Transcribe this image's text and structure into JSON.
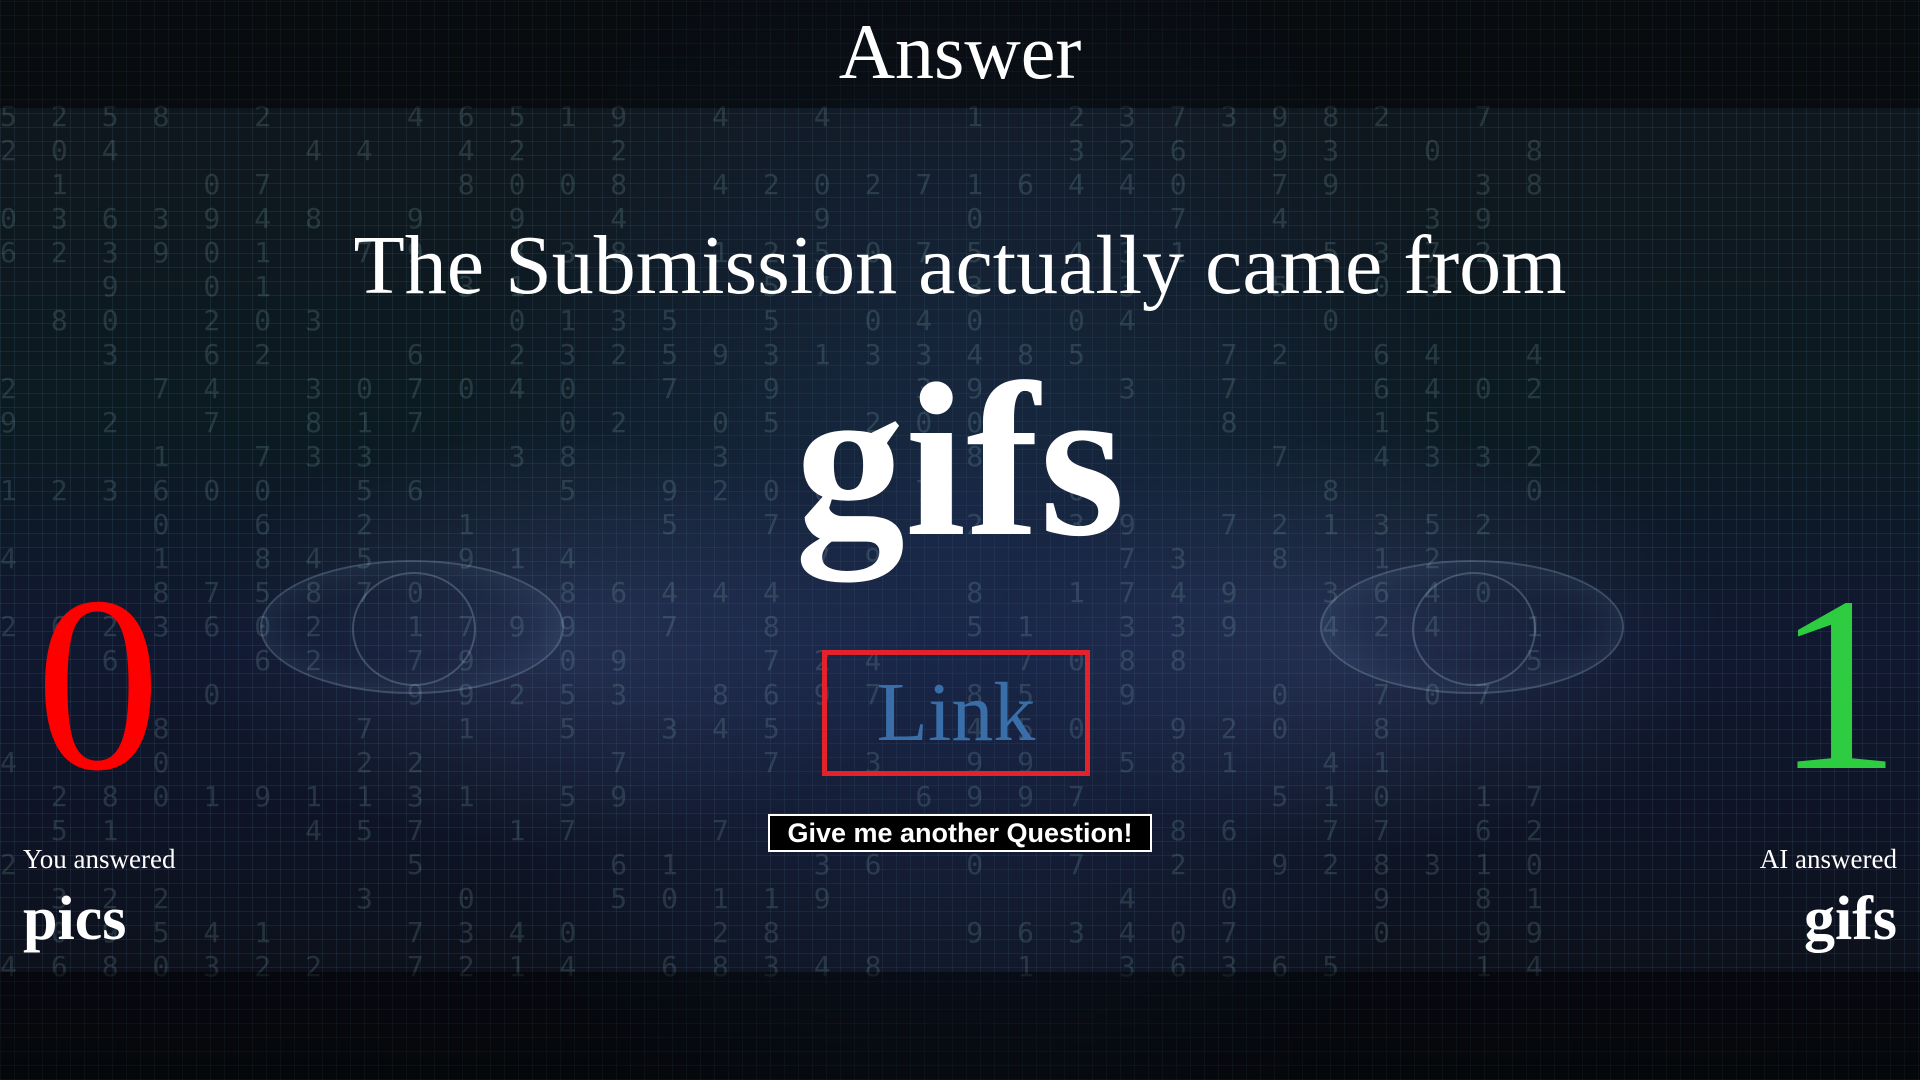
{
  "header": {
    "title": "Answer"
  },
  "result": {
    "intro": "The Submission actually came from",
    "correct_answer": "gifs",
    "link_label": "Link"
  },
  "actions": {
    "next_question_label": "Give me another Question!"
  },
  "player": {
    "score": "0",
    "answered_label": "You answered",
    "answer": "pics",
    "score_color": "#ff0000"
  },
  "ai": {
    "score": "1",
    "answered_label": "AI answered",
    "answer": "gifs",
    "score_color": "#2ecc40"
  },
  "colors": {
    "link_border": "#e2232b",
    "link_text": "#3a6ea8"
  }
}
